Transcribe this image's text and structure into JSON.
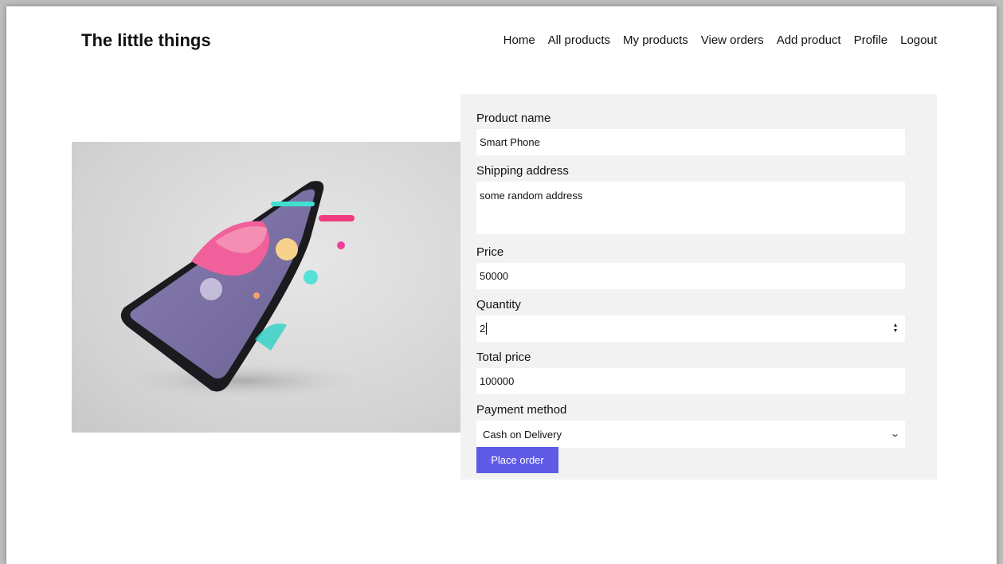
{
  "header": {
    "brand": "The little things",
    "nav": [
      "Home",
      "All products",
      "My products",
      "View orders",
      "Add product",
      "Profile",
      "Logout"
    ]
  },
  "form": {
    "product_name": {
      "label": "Product name",
      "value": "Smart Phone"
    },
    "shipping_address": {
      "label": "Shipping address",
      "value": "some random address"
    },
    "price": {
      "label": "Price",
      "value": "50000"
    },
    "quantity": {
      "label": "Quantity",
      "value": "2"
    },
    "total_price": {
      "label": "Total price",
      "value": "100000"
    },
    "payment_method": {
      "label": "Payment method",
      "value": "Cash on Delivery"
    },
    "submit_label": "Place order"
  },
  "colors": {
    "accent": "#5f5be6",
    "panel_bg": "#f2f2f2"
  },
  "icons": {
    "spinner": "number-spinner-icon",
    "select": "chevron-down-icon"
  }
}
